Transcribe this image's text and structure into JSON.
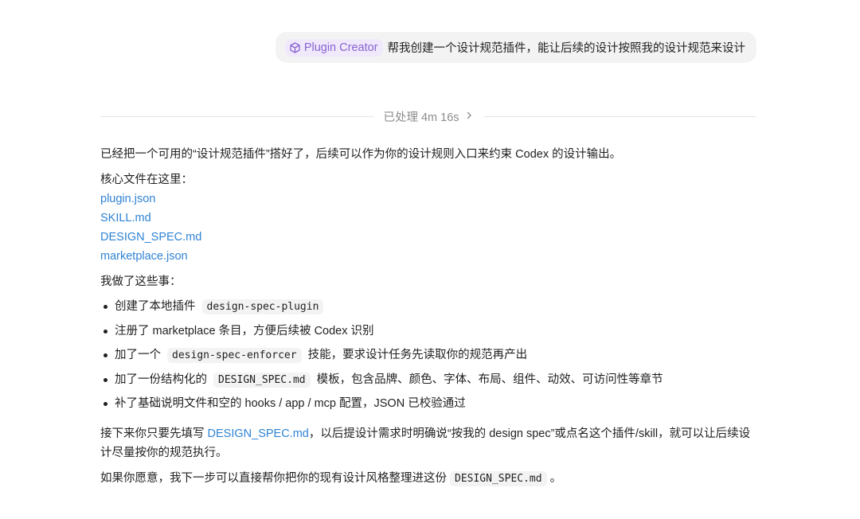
{
  "user_message": {
    "mention_label": "Plugin Creator",
    "mention_icon": "plugin-cube-icon",
    "text": "帮我创建一个设计规范插件，能让后续的设计按照我的设计规范来设计"
  },
  "status": {
    "processed_label": "已处理 4m 16s",
    "expand_icon": "chevron-right-icon"
  },
  "assistant": {
    "intro": "已经把一个可用的“设计规范插件”搭好了，后续可以作为你的设计规则入口来约束 Codex 的设计输出。",
    "files_heading": "核心文件在这里：",
    "files": [
      "plugin.json",
      "SKILL.md",
      "DESIGN_SPEC.md",
      "marketplace.json"
    ],
    "done_heading": "我做了这些事：",
    "bullets": [
      {
        "before": "创建了本地插件",
        "code": "design-spec-plugin",
        "after": ""
      },
      {
        "before": "注册了 marketplace 条目，方便后续被 Codex 识别",
        "code": "",
        "after": ""
      },
      {
        "before": "加了一个",
        "code": "design-spec-enforcer",
        "after": "技能，要求设计任务先读取你的规范再产出"
      },
      {
        "before": "加了一份结构化的",
        "code": "DESIGN_SPEC.md",
        "after": "模板，包含品牌、颜色、字体、布局、组件、动效、可访问性等章节"
      },
      {
        "before": "补了基础说明文件和空的 hooks / app / mcp 配置，JSON 已校验通过",
        "code": "",
        "after": ""
      }
    ],
    "next_before": "接下来你只要先填写",
    "next_link": "DESIGN_SPEC.md",
    "next_after": "，以后提设计需求时明确说“按我的 design spec”或点名这个插件/skill，就可以让后续设计尽量按你的规范执行。",
    "offer_before": "如果你愿意，我下一步可以直接帮你把你的现有设计风格整理进这份",
    "offer_code": "DESIGN_SPEC.md",
    "offer_after": "。"
  },
  "colors": {
    "link": "#2f83d4",
    "mention_text": "#8a63d2",
    "mention_bg": "#efe9fb",
    "bubble_bg": "#f3f3f4",
    "muted": "#8c8c8c"
  }
}
